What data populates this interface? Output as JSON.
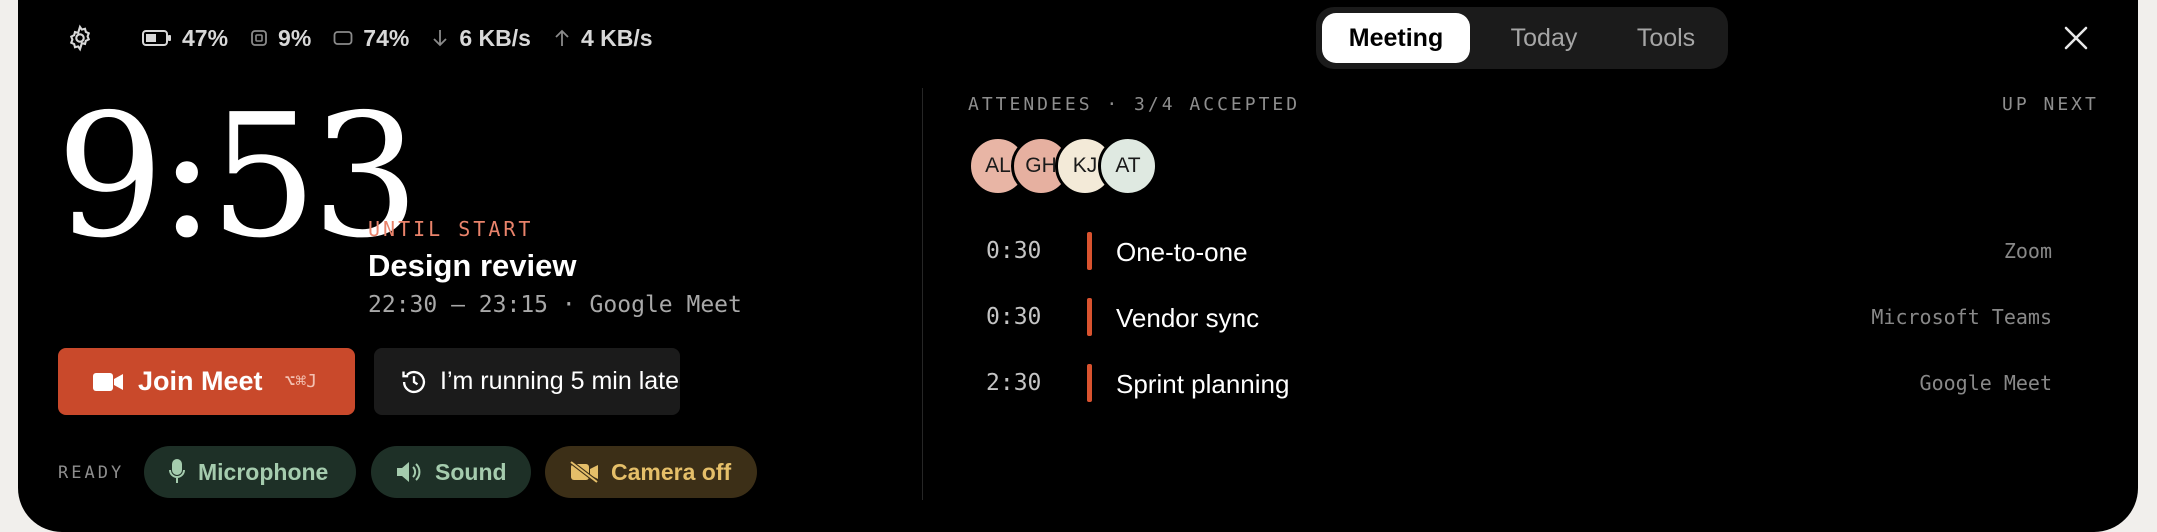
{
  "status": {
    "battery": "47%",
    "cpu": "9%",
    "memory": "74%",
    "download": "6 KB/s",
    "upload": "4 KB/s"
  },
  "tabs": [
    {
      "label": "Meeting",
      "active": true
    },
    {
      "label": "Today",
      "active": false
    },
    {
      "label": "Tools",
      "active": false
    }
  ],
  "countdown": "9:53",
  "meeting": {
    "until_label": "UNTIL START",
    "title": "Design review",
    "time": "22:30 — 23:15 · Google Meet"
  },
  "actions": {
    "join_label": "Join Meet",
    "join_shortcut": "⌥⌘J",
    "late_label": "I’m running 5 min late"
  },
  "ready": {
    "label": "READY",
    "microphone": "Microphone",
    "sound": "Sound",
    "camera": "Camera off"
  },
  "attendees": {
    "header": "ATTENDEES · 3/4 ACCEPTED",
    "people": [
      {
        "initials": "AL",
        "color": "#e8b5a5"
      },
      {
        "initials": "GH",
        "color": "#e6b0a0"
      },
      {
        "initials": "KJ",
        "color": "#f3ead8"
      },
      {
        "initials": "AT",
        "color": "#dfe9e1"
      }
    ]
  },
  "up_next": {
    "header": "UP NEXT",
    "items": [
      {
        "duration": "0:30",
        "name": "One-to-one",
        "platform": "Zoom"
      },
      {
        "duration": "0:30",
        "name": "Vendor sync",
        "platform": "Microsoft Teams"
      },
      {
        "duration": "2:30",
        "name": "Sprint planning",
        "platform": "Google Meet"
      }
    ]
  },
  "colors": {
    "accent": "#c9492b",
    "ready_green": "#a5ccae",
    "camera_amber": "#e5bf69"
  }
}
